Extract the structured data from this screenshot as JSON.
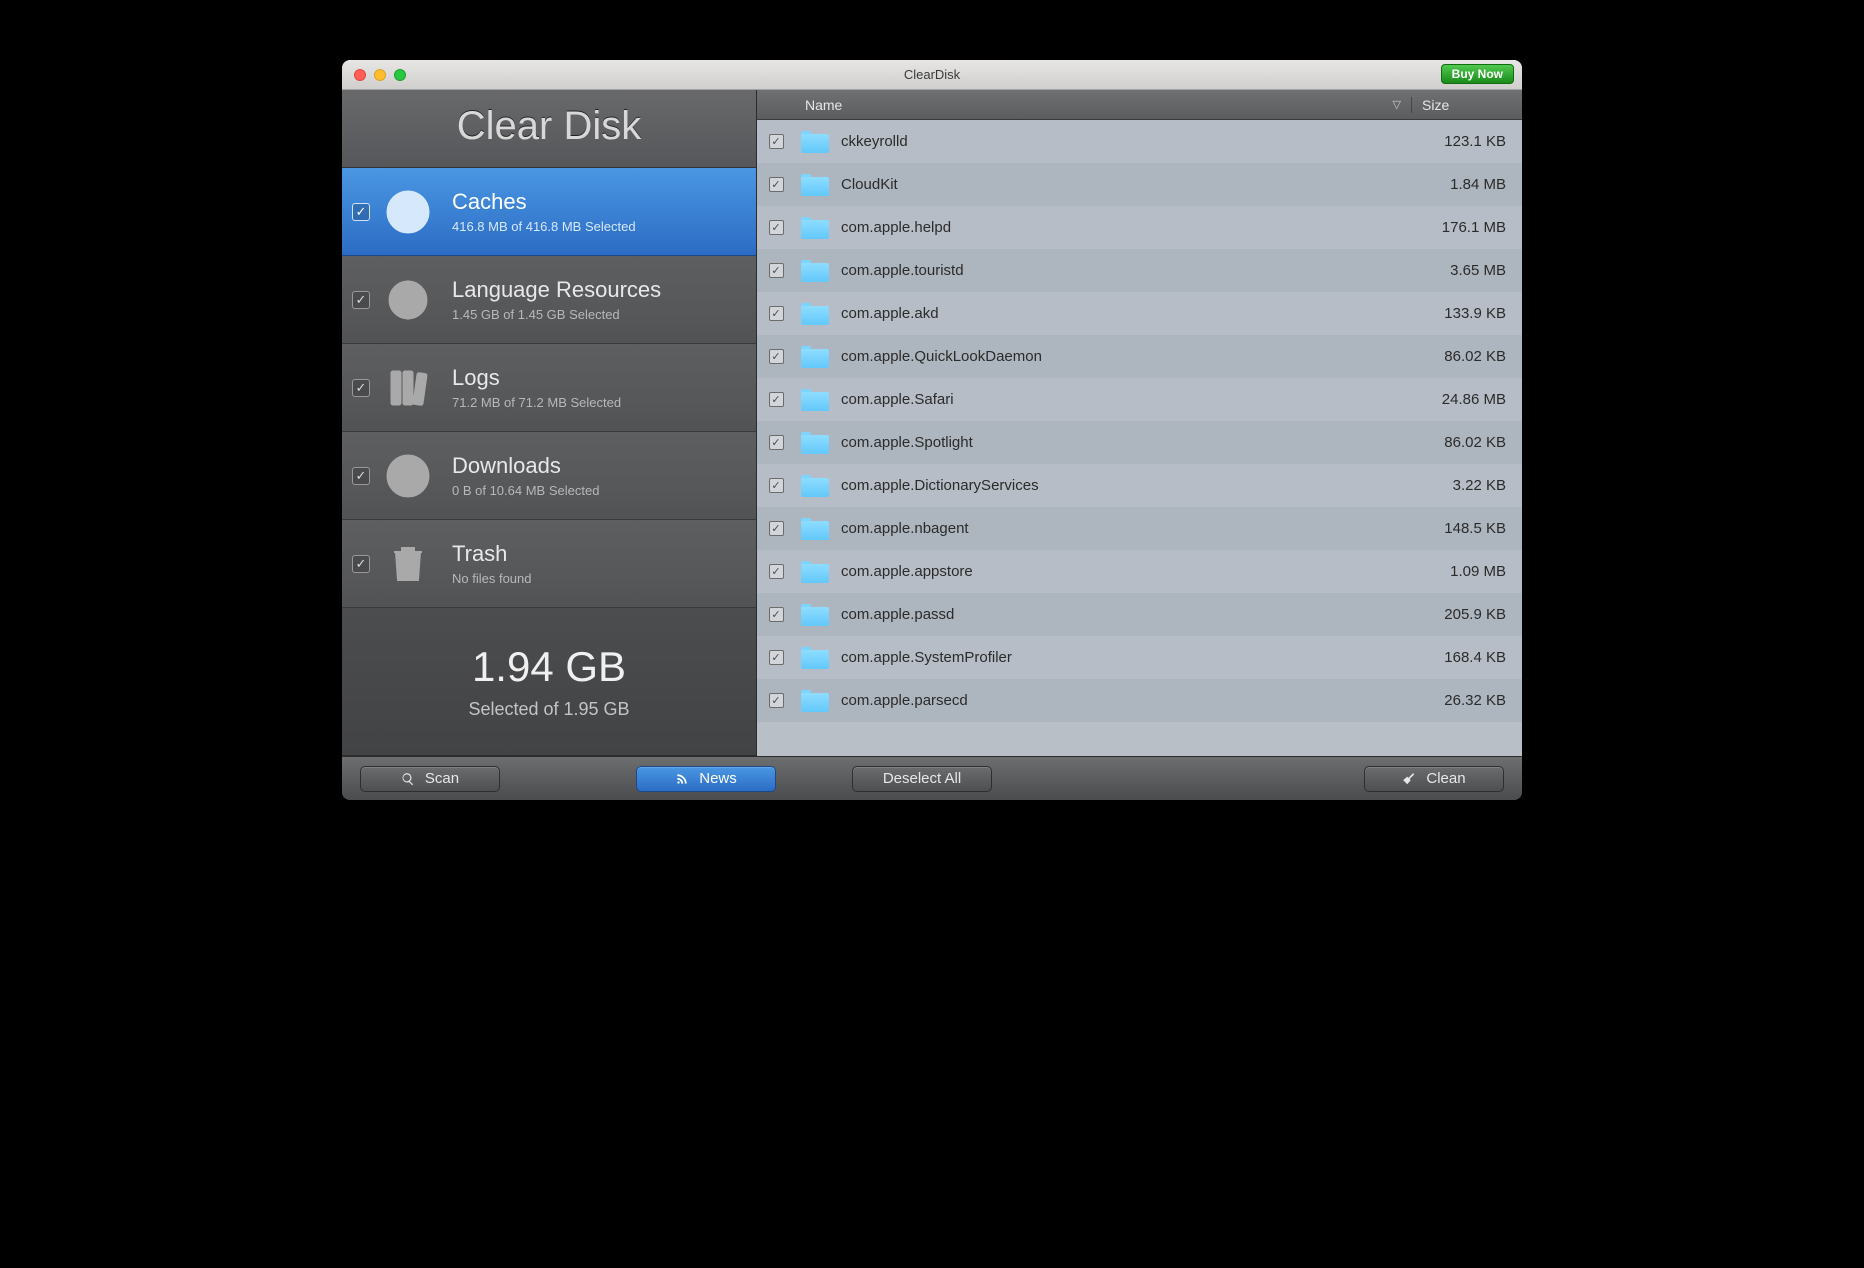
{
  "window": {
    "title": "ClearDisk",
    "buy_label": "Buy Now"
  },
  "app_title": "Clear Disk",
  "categories": [
    {
      "checked": true,
      "selected": true,
      "icon": "clock",
      "title": "Caches",
      "subtitle": "416.8 MB of 416.8 MB Selected"
    },
    {
      "checked": true,
      "selected": false,
      "icon": "globe",
      "title": "Language Resources",
      "subtitle": "1.45 GB of 1.45 GB Selected"
    },
    {
      "checked": true,
      "selected": false,
      "icon": "binders",
      "title": "Logs",
      "subtitle": "71.2 MB of 71.2 MB Selected"
    },
    {
      "checked": true,
      "selected": false,
      "icon": "download",
      "title": "Downloads",
      "subtitle": "0 B of 10.64 MB Selected"
    },
    {
      "checked": true,
      "selected": false,
      "icon": "trash",
      "title": "Trash",
      "subtitle": "No files found"
    }
  ],
  "summary": {
    "big": "1.94 GB",
    "sub": "Selected of 1.95 GB"
  },
  "columns": {
    "name": "Name",
    "size": "Size"
  },
  "rows": [
    {
      "checked": true,
      "name": "ckkeyrolld",
      "size": "123.1 KB"
    },
    {
      "checked": true,
      "name": "CloudKit",
      "size": "1.84 MB"
    },
    {
      "checked": true,
      "name": "com.apple.helpd",
      "size": "176.1 MB"
    },
    {
      "checked": true,
      "name": "com.apple.touristd",
      "size": "3.65 MB"
    },
    {
      "checked": true,
      "name": "com.apple.akd",
      "size": "133.9 KB"
    },
    {
      "checked": true,
      "name": "com.apple.QuickLookDaemon",
      "size": "86.02 KB"
    },
    {
      "checked": true,
      "name": "com.apple.Safari",
      "size": "24.86 MB"
    },
    {
      "checked": true,
      "name": "com.apple.Spotlight",
      "size": "86.02 KB"
    },
    {
      "checked": true,
      "name": "com.apple.DictionaryServices",
      "size": "3.22 KB"
    },
    {
      "checked": true,
      "name": "com.apple.nbagent",
      "size": "148.5 KB"
    },
    {
      "checked": true,
      "name": "com.apple.appstore",
      "size": "1.09 MB"
    },
    {
      "checked": true,
      "name": "com.apple.passd",
      "size": "205.9 KB"
    },
    {
      "checked": true,
      "name": "com.apple.SystemProfiler",
      "size": "168.4 KB"
    },
    {
      "checked": true,
      "name": "com.apple.parsecd",
      "size": "26.32 KB"
    }
  ],
  "buttons": {
    "scan": "Scan",
    "news": "News",
    "deselect_all": "Deselect All",
    "clean": "Clean"
  }
}
